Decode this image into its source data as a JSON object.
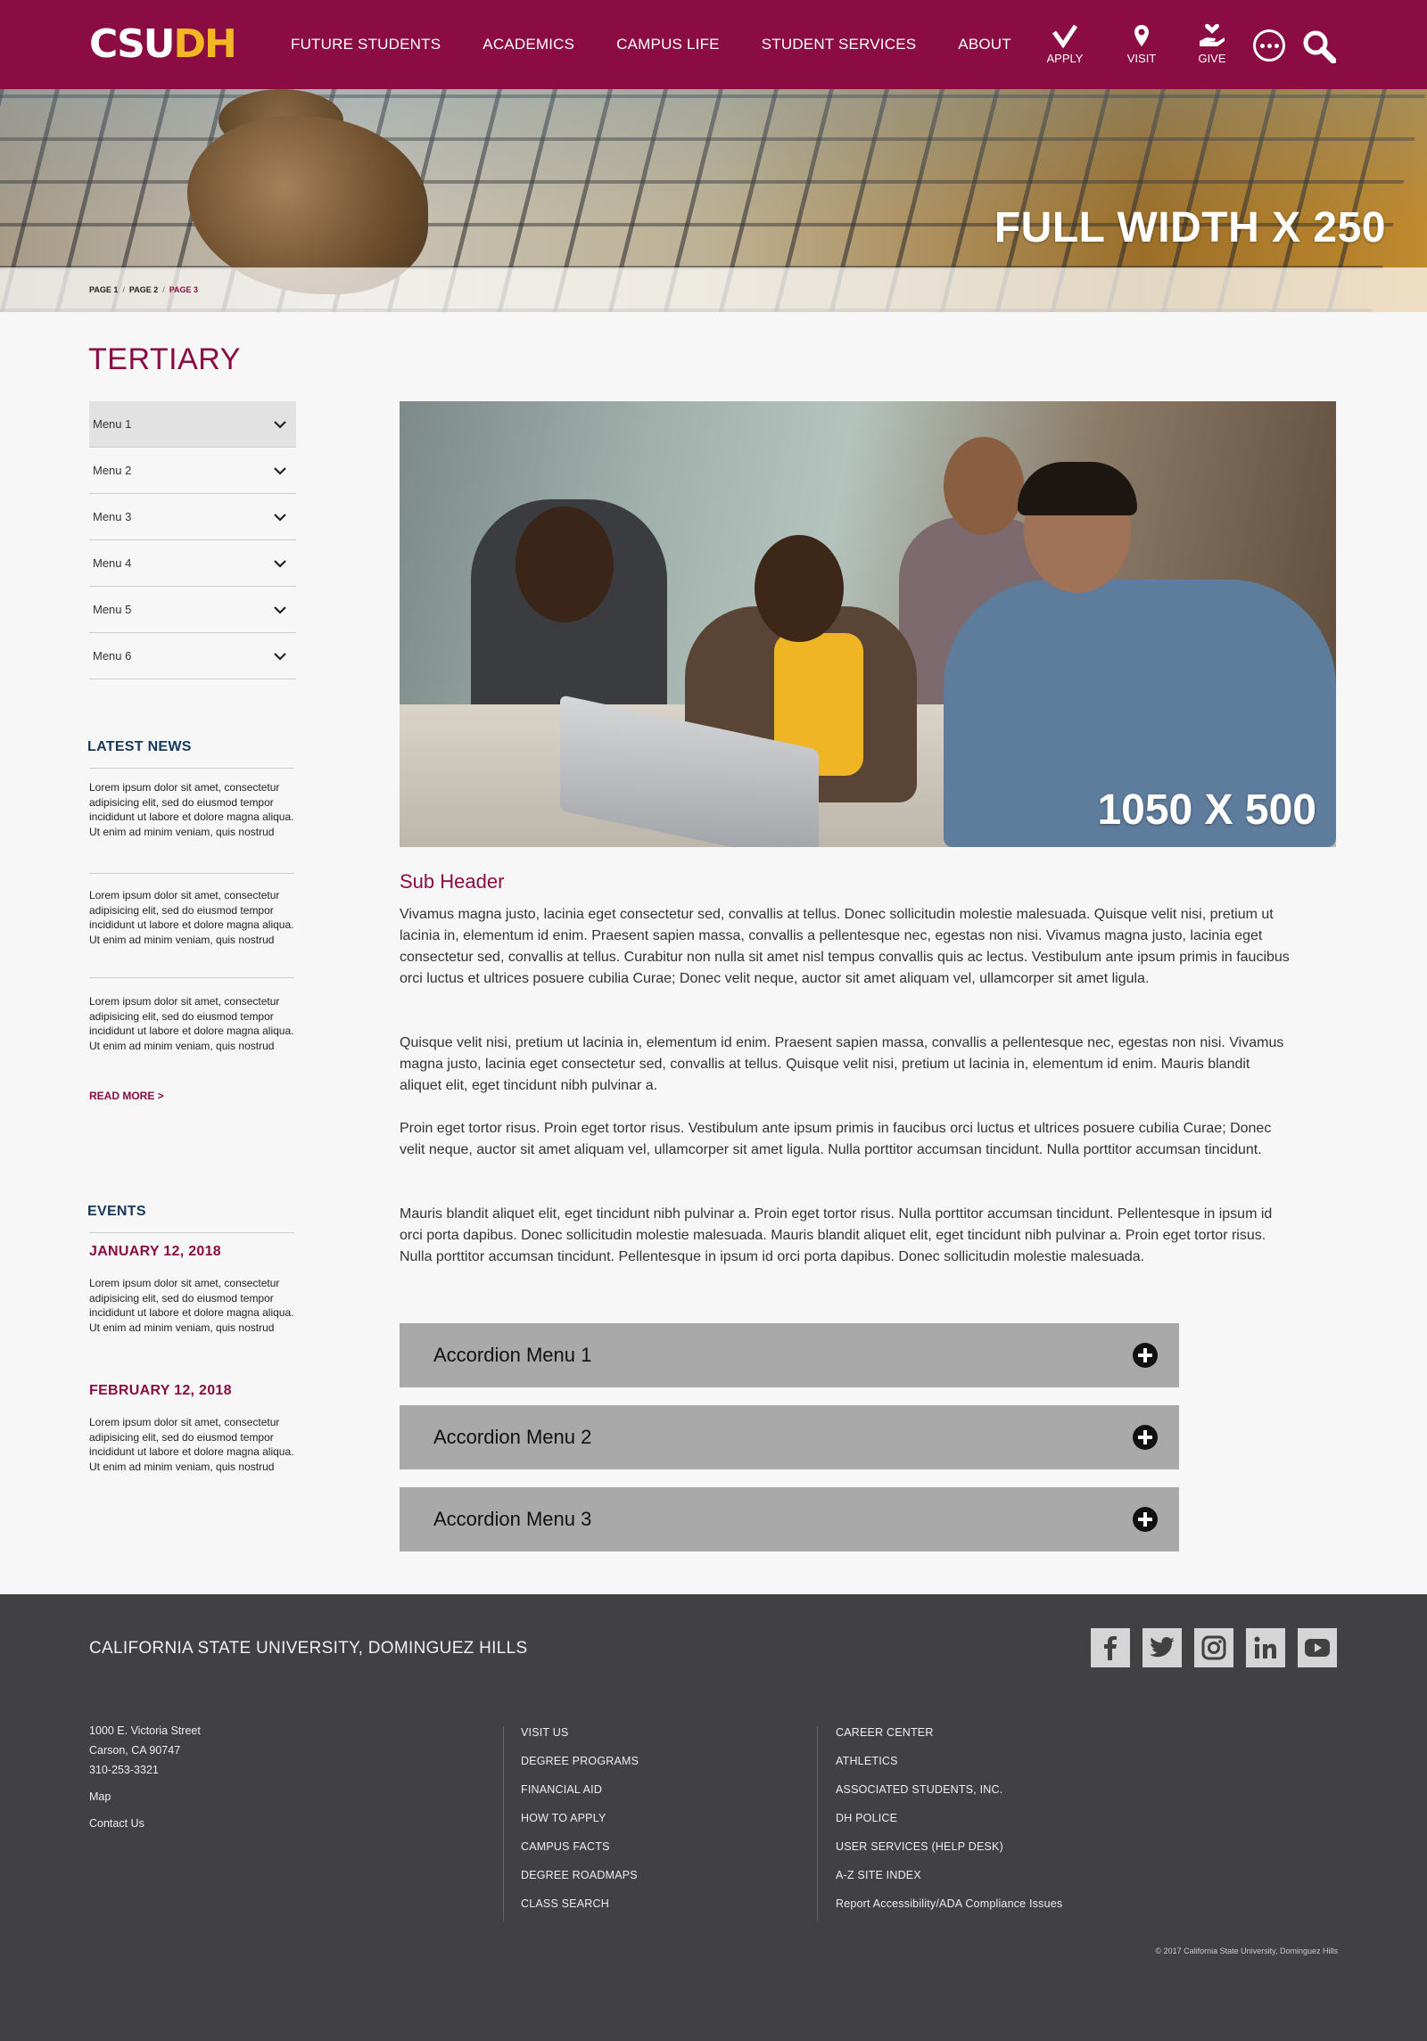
{
  "header": {
    "logo": {
      "cs": "CSU",
      "dh": "DH"
    },
    "nav": [
      "FUTURE STUDENTS",
      "ACADEMICS",
      "CAMPUS LIFE",
      "STUDENT SERVICES",
      "ABOUT"
    ],
    "quick_links": {
      "apply": "APPLY",
      "visit": "VISIT",
      "give": "GIVE"
    }
  },
  "hero": {
    "title": "FULL WIDTH X 250"
  },
  "breadcrumb": {
    "items": [
      "PAGE 1",
      "PAGE 2",
      "PAGE 3"
    ],
    "separator": "/"
  },
  "sidebar": {
    "title": "TERTIARY",
    "menu": [
      "Menu 1",
      "Menu 2",
      "Menu 3",
      "Menu 4",
      "Menu 5",
      "Menu 6"
    ],
    "news": {
      "heading": "LATEST NEWS",
      "items": [
        "Lorem ipsum dolor sit amet, consectetur adipisicing elit, sed do eiusmod tempor incididunt ut labore et dolore magna aliqua. Ut enim ad minim veniam, quis nostrud",
        "Lorem ipsum dolor sit amet, consectetur adipisicing elit, sed do eiusmod tempor incididunt ut labore et dolore magna aliqua. Ut enim ad minim veniam, quis nostrud",
        "Lorem ipsum dolor sit amet, consectetur adipisicing elit, sed do eiusmod tempor incididunt ut labore et dolore magna aliqua. Ut enim ad minim veniam, quis nostrud"
      ],
      "read_more": "READ MORE >"
    },
    "events": {
      "heading": "EVENTS",
      "items": [
        {
          "date": "JANUARY 12, 2018",
          "text": "Lorem ipsum dolor sit amet, consectetur adipisicing elit, sed do eiusmod tempor incididunt ut labore et dolore magna aliqua. Ut enim ad minim veniam, quis nostrud"
        },
        {
          "date": "FEBRUARY 12, 2018",
          "text": "Lorem ipsum dolor sit amet, consectetur adipisicing elit, sed do eiusmod tempor incididunt ut labore et dolore magna aliqua. Ut enim ad minim veniam, quis nostrud"
        }
      ]
    }
  },
  "main": {
    "feature_label": "1050 X 500",
    "sub_header": "Sub Header",
    "paragraphs": [
      "Vivamus magna justo, lacinia eget consectetur sed, convallis at tellus. Donec sollicitudin molestie malesuada. Quisque velit nisi, pretium ut lacinia in, elementum id enim. Praesent sapien massa, convallis a pellentesque nec, egestas non nisi. Vivamus magna justo, lacinia eget consectetur sed, convallis at tellus. Curabitur non nulla sit amet nisl tempus convallis quis ac lectus. Vestibulum ante ipsum primis in faucibus orci luctus et ultrices posuere cubilia Curae; Donec velit neque, auctor sit amet aliquam vel, ullamcorper sit amet ligula.",
      "Quisque velit nisi, pretium ut lacinia in, elementum id enim. Praesent sapien massa, convallis a pellentesque nec, egestas non nisi. Vivamus magna justo, lacinia eget consectetur sed, convallis at tellus. Quisque velit nisi, pretium ut lacinia in, elementum id enim. Mauris blandit aliquet elit, eget tincidunt nibh pulvinar a.",
      "Proin eget tortor risus. Proin eget tortor risus. Vestibulum ante ipsum primis in faucibus orci luctus et ultrices posuere cubilia Curae; Donec velit neque, auctor sit amet aliquam vel, ullamcorper sit amet ligula. Nulla porttitor accumsan tincidunt. Nulla porttitor accumsan tincidunt.",
      "Mauris blandit aliquet elit, eget tincidunt nibh pulvinar a. Proin eget tortor risus. Nulla porttitor accumsan tincidunt. Pellentesque in ipsum id orci porta dapibus. Donec sollicitudin molestie malesuada. Mauris blandit aliquet elit, eget tincidunt nibh pulvinar a. Proin eget tortor risus. Nulla porttitor accumsan tincidunt. Pellentesque in ipsum id orci porta dapibus. Donec sollicitudin molestie malesuada."
    ],
    "accordions": [
      "Accordion Menu 1",
      "Accordion Menu 2",
      "Accordion Menu 3"
    ]
  },
  "footer": {
    "title": "CALIFORNIA STATE UNIVERSITY, DOMINGUEZ HILLS",
    "social": [
      "facebook-icon",
      "twitter-icon",
      "instagram-icon",
      "linkedin-icon",
      "youtube-icon"
    ],
    "address": [
      "1000 E. Victoria Street",
      "Carson, CA 90747",
      "310-253-3321"
    ],
    "address_links": [
      "Map",
      "Contact Us"
    ],
    "col2": [
      "VISIT US",
      "DEGREE PROGRAMS",
      "FINANCIAL AID",
      "HOW TO APPLY",
      "CAMPUS FACTS",
      "DEGREE ROADMAPS",
      "CLASS SEARCH"
    ],
    "col3": [
      "CAREER CENTER",
      "ATHLETICS",
      "ASSOCIATED STUDENTS, INC.",
      "DH POLICE",
      "USER SERVICES (HELP DESK)",
      "A-Z SITE INDEX",
      "Report Accessibility/ADA Compliance Issues"
    ],
    "copyright": "© 2017 California State University, Dominguez Hills"
  },
  "colors": {
    "brand": "#8a0c43",
    "gold": "#f2b823",
    "navy": "#16395b",
    "footer": "#414143",
    "accordion": "#a9a9a9"
  }
}
